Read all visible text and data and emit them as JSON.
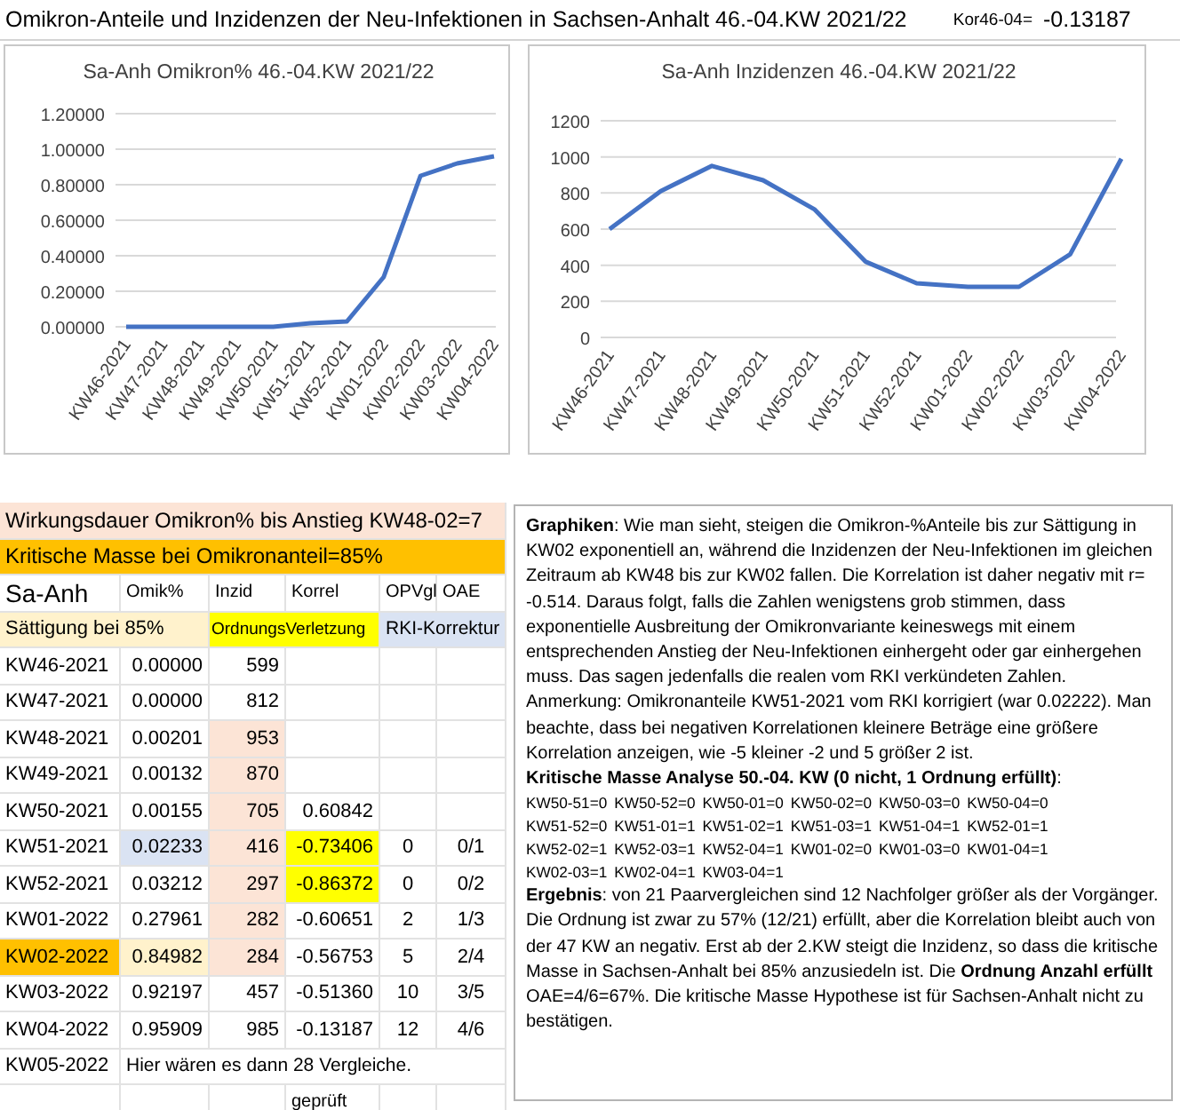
{
  "header": {
    "title": "Omikron-Anteile und Inzidenzen der Neu-Infektionen in Sachsen-Anhalt 46.-04.KW 2021/22",
    "kor_label": "Kor46-04=",
    "kor_value": "-0.13187"
  },
  "charts": [
    {
      "chart_data": {
        "type": "line",
        "title": "Sa-Anh Omikron% 46.-04.KW 2021/22",
        "grid": true,
        "categories": [
          "KW46-2021",
          "KW47-2021",
          "KW48-2021",
          "KW49-2021",
          "KW50-2021",
          "KW51-2021",
          "KW52-2021",
          "KW01-2022",
          "KW02-2022",
          "KW03-2022",
          "KW04-2022"
        ],
        "series": [
          {
            "color": "#4472c4",
            "values": [
              0,
              0,
              0,
              0,
              0,
              0.02,
              0.03,
              0.28,
              0.85,
              0.92,
              0.96
            ]
          }
        ],
        "ylim": [
          0,
          1.2
        ],
        "yticks": [
          {
            "value": 0,
            "label": "0.00000"
          },
          {
            "value": 0.2,
            "label": "0.20000"
          },
          {
            "value": 0.4,
            "label": "0.40000"
          },
          {
            "value": 0.6,
            "label": "0.60000"
          },
          {
            "value": 0.8,
            "label": "0.80000"
          },
          {
            "value": 1,
            "label": "1.00000"
          },
          {
            "value": 1.2,
            "label": "1.20000"
          }
        ]
      }
    },
    {
      "chart_data": {
        "type": "line",
        "title": "Sa-Anh Inzidenzen 46.-04.KW 2021/22",
        "grid": true,
        "categories": [
          "KW46-2021",
          "KW47-2021",
          "KW48-2021",
          "KW49-2021",
          "KW50-2021",
          "KW51-2021",
          "KW52-2021",
          "KW01-2022",
          "KW02-2022",
          "KW03-2022",
          "KW04-2022"
        ],
        "series": [
          {
            "color": "#4472c4",
            "values": [
              600,
              810,
              950,
              870,
              710,
              420,
              300,
              280,
              280,
              460,
              990
            ]
          }
        ],
        "ylim": [
          0,
          1200
        ],
        "yticks": [
          0,
          200,
          400,
          600,
          800,
          1000,
          1200
        ]
      }
    }
  ],
  "table": {
    "notes": [
      {
        "text": "Wirkungsdauer Omikron% bis Anstieg KW48-02=7",
        "kind": "duration"
      },
      {
        "text": "Kritische Masse bei Omikronanteil=85%",
        "kind": "critical"
      }
    ],
    "columns": [
      "Sa-Anh",
      "Omik%",
      "Inzid",
      "Korrel",
      "OPVgl",
      "OAE"
    ],
    "legend": [
      {
        "text": "Sättigung bei 85%",
        "kind": "saturation"
      },
      {
        "text": "OrdnungsVerletzung",
        "kind": "violation"
      },
      {
        "text": "RKI-Korrektur",
        "kind": "correction"
      }
    ],
    "rows": [
      {
        "week": "KW46-2021",
        "week_critical": false,
        "omik": "0.00000",
        "omik_corrected": false,
        "omik_saturated": false,
        "inzid": "599",
        "inzid_in_duration": false,
        "korrel_violation": false
      },
      {
        "week": "KW47-2021",
        "week_critical": false,
        "omik": "0.00000",
        "omik_corrected": false,
        "omik_saturated": false,
        "inzid": "812",
        "inzid_in_duration": false,
        "korrel_violation": false
      },
      {
        "week": "KW48-2021",
        "week_critical": false,
        "omik": "0.00201",
        "omik_corrected": false,
        "omik_saturated": false,
        "inzid": "953",
        "inzid_in_duration": true,
        "korrel_violation": false
      },
      {
        "week": "KW49-2021",
        "week_critical": false,
        "omik": "0.00132",
        "omik_corrected": false,
        "omik_saturated": false,
        "inzid": "870",
        "inzid_in_duration": true,
        "korrel_violation": false
      },
      {
        "week": "KW50-2021",
        "week_critical": false,
        "omik": "0.00155",
        "omik_corrected": false,
        "omik_saturated": false,
        "inzid": "705",
        "inzid_in_duration": true,
        "korrel": "0.60842",
        "korrel_violation": false
      },
      {
        "week": "KW51-2021",
        "week_critical": false,
        "omik": "0.02233",
        "omik_corrected": true,
        "omik_saturated": false,
        "inzid": "416",
        "inzid_in_duration": true,
        "korrel": "-0.73406",
        "korrel_violation": true,
        "opvgl": "0",
        "oae": "0/1"
      },
      {
        "week": "KW52-2021",
        "week_critical": false,
        "omik": "0.03212",
        "omik_corrected": false,
        "omik_saturated": false,
        "inzid": "297",
        "inzid_in_duration": true,
        "korrel": "-0.86372",
        "korrel_violation": true,
        "opvgl": "0",
        "oae": "0/2"
      },
      {
        "week": "KW01-2022",
        "week_critical": false,
        "omik": "0.27961",
        "omik_corrected": false,
        "omik_saturated": false,
        "inzid": "282",
        "inzid_in_duration": true,
        "korrel": "-0.60651",
        "korrel_violation": false,
        "opvgl": "2",
        "oae": "1/3"
      },
      {
        "week": "KW02-2022",
        "week_critical": true,
        "omik": "0.84982",
        "omik_corrected": false,
        "omik_saturated": true,
        "inzid": "284",
        "inzid_in_duration": true,
        "korrel": "-0.56753",
        "korrel_violation": false,
        "opvgl": "5",
        "oae": "2/4"
      },
      {
        "week": "KW03-2022",
        "week_critical": false,
        "omik": "0.92197",
        "omik_corrected": false,
        "omik_saturated": false,
        "inzid": "457",
        "inzid_in_duration": false,
        "korrel": "-0.51360",
        "korrel_violation": false,
        "opvgl": "10",
        "oae": "3/5"
      },
      {
        "week": "KW04-2022",
        "week_critical": false,
        "omik": "0.95909",
        "omik_corrected": false,
        "omik_saturated": false,
        "inzid": "985",
        "inzid_in_duration": false,
        "korrel": "-0.13187",
        "korrel_violation": false,
        "opvgl": "12",
        "oae": "4/6"
      }
    ],
    "last_week": {
      "week": "KW05-2022",
      "note": "Hier wären es dann 28 Vergleiche."
    },
    "status": "geprüft"
  },
  "text_box": {
    "blocks": [
      {
        "kind": "text",
        "text": "**Graphiken**: Wie man sieht, steigen die Omikron-%Anteile bis zur Sättigung in KW02 exponentiell an, während die Inzidenzen der Neu-Infektionen im gleichen Zeitraum ab KW48 bis zur KW02 fallen. Die Korrelation ist daher negativ mit r= -0.514. Daraus folgt, falls die Zahlen wenigstens grob stimmen, dass exponentielle Ausbreitung der Omikronvariante keineswegs mit einem entsprechenden Anstieg der Neu-Infektionen einhergeht oder gar einhergehen muss. Das sagen jedenfalls die realen vom RKI verkündeten Zahlen. Anmerkung: Omikronanteile KW51-2021 vom RKI korrigiert (war 0.02222). Man beachte, dass bei negativen Korrelationen kleinere Beträge eine größere Korrelation anzeigen, wie -5 kleiner -2 und 5 größer 2 ist."
      },
      {
        "kind": "text",
        "text": "**Kritische Masse Analyse 50.-04. KW (0 nicht, 1 Ordnung erfüllt)**:"
      },
      {
        "kind": "pairs",
        "items": [
          "KW50-51=0",
          "KW50-52=0",
          "KW50-01=0",
          "KW50-02=0",
          "KW50-03=0",
          "KW50-04=0",
          "KW51-52=0",
          "KW51-01=1",
          "KW51-02=1",
          "KW51-03=1",
          "KW51-04=1",
          "KW52-01=1",
          "KW52-02=1",
          "KW52-03=1",
          "KW52-04=1",
          "KW01-02=0",
          "KW01-03=0",
          "KW01-04=1",
          "KW02-03=1",
          "KW02-04=1",
          "KW03-04=1"
        ]
      },
      {
        "kind": "text",
        "text": "**Ergebnis**: von 21 Paarvergleichen sind 12 Nachfolger größer als der Vorgänger. Die Ordnung ist zwar zu 57% (12/21) erfüllt, aber die Korrelation bleibt auch von der 47 KW an negativ. Erst ab der 2.KW steigt die Inzidenz, so dass die kritische Masse in Sachsen-Anhalt bei 85% anzusiedeln ist. Die **Ordnung Anzahl erfüllt** OAE=4/6=67%. Die kritische Masse Hypothese ist für Sachsen-Anhalt nicht zu bestätigen."
      }
    ]
  }
}
